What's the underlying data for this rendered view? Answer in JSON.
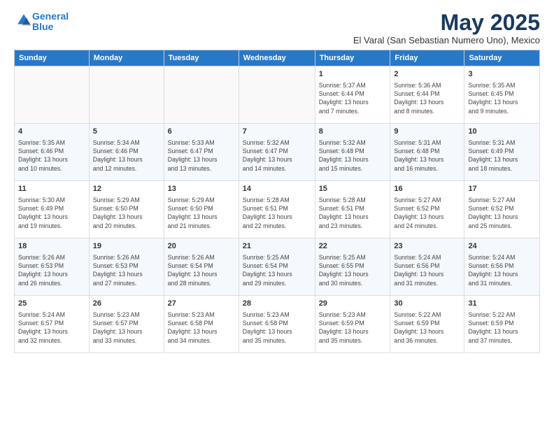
{
  "header": {
    "logo_line1": "General",
    "logo_line2": "Blue",
    "month": "May 2025",
    "location": "El Varal (San Sebastian Numero Uno), Mexico"
  },
  "weekdays": [
    "Sunday",
    "Monday",
    "Tuesday",
    "Wednesday",
    "Thursday",
    "Friday",
    "Saturday"
  ],
  "weeks": [
    [
      {
        "day": "",
        "info": ""
      },
      {
        "day": "",
        "info": ""
      },
      {
        "day": "",
        "info": ""
      },
      {
        "day": "",
        "info": ""
      },
      {
        "day": "1",
        "info": "Sunrise: 5:37 AM\nSunset: 6:44 PM\nDaylight: 13 hours\nand 7 minutes."
      },
      {
        "day": "2",
        "info": "Sunrise: 5:36 AM\nSunset: 6:44 PM\nDaylight: 13 hours\nand 8 minutes."
      },
      {
        "day": "3",
        "info": "Sunrise: 5:35 AM\nSunset: 6:45 PM\nDaylight: 13 hours\nand 9 minutes."
      }
    ],
    [
      {
        "day": "4",
        "info": "Sunrise: 5:35 AM\nSunset: 6:46 PM\nDaylight: 13 hours\nand 10 minutes."
      },
      {
        "day": "5",
        "info": "Sunrise: 5:34 AM\nSunset: 6:46 PM\nDaylight: 13 hours\nand 12 minutes."
      },
      {
        "day": "6",
        "info": "Sunrise: 5:33 AM\nSunset: 6:47 PM\nDaylight: 13 hours\nand 13 minutes."
      },
      {
        "day": "7",
        "info": "Sunrise: 5:32 AM\nSunset: 6:47 PM\nDaylight: 13 hours\nand 14 minutes."
      },
      {
        "day": "8",
        "info": "Sunrise: 5:32 AM\nSunset: 6:48 PM\nDaylight: 13 hours\nand 15 minutes."
      },
      {
        "day": "9",
        "info": "Sunrise: 5:31 AM\nSunset: 6:48 PM\nDaylight: 13 hours\nand 16 minutes."
      },
      {
        "day": "10",
        "info": "Sunrise: 5:31 AM\nSunset: 6:49 PM\nDaylight: 13 hours\nand 18 minutes."
      }
    ],
    [
      {
        "day": "11",
        "info": "Sunrise: 5:30 AM\nSunset: 6:49 PM\nDaylight: 13 hours\nand 19 minutes."
      },
      {
        "day": "12",
        "info": "Sunrise: 5:29 AM\nSunset: 6:50 PM\nDaylight: 13 hours\nand 20 minutes."
      },
      {
        "day": "13",
        "info": "Sunrise: 5:29 AM\nSunset: 6:50 PM\nDaylight: 13 hours\nand 21 minutes."
      },
      {
        "day": "14",
        "info": "Sunrise: 5:28 AM\nSunset: 6:51 PM\nDaylight: 13 hours\nand 22 minutes."
      },
      {
        "day": "15",
        "info": "Sunrise: 5:28 AM\nSunset: 6:51 PM\nDaylight: 13 hours\nand 23 minutes."
      },
      {
        "day": "16",
        "info": "Sunrise: 5:27 AM\nSunset: 6:52 PM\nDaylight: 13 hours\nand 24 minutes."
      },
      {
        "day": "17",
        "info": "Sunrise: 5:27 AM\nSunset: 6:52 PM\nDaylight: 13 hours\nand 25 minutes."
      }
    ],
    [
      {
        "day": "18",
        "info": "Sunrise: 5:26 AM\nSunset: 6:53 PM\nDaylight: 13 hours\nand 26 minutes."
      },
      {
        "day": "19",
        "info": "Sunrise: 5:26 AM\nSunset: 6:53 PM\nDaylight: 13 hours\nand 27 minutes."
      },
      {
        "day": "20",
        "info": "Sunrise: 5:26 AM\nSunset: 6:54 PM\nDaylight: 13 hours\nand 28 minutes."
      },
      {
        "day": "21",
        "info": "Sunrise: 5:25 AM\nSunset: 6:54 PM\nDaylight: 13 hours\nand 29 minutes."
      },
      {
        "day": "22",
        "info": "Sunrise: 5:25 AM\nSunset: 6:55 PM\nDaylight: 13 hours\nand 30 minutes."
      },
      {
        "day": "23",
        "info": "Sunrise: 5:24 AM\nSunset: 6:56 PM\nDaylight: 13 hours\nand 31 minutes."
      },
      {
        "day": "24",
        "info": "Sunrise: 5:24 AM\nSunset: 6:56 PM\nDaylight: 13 hours\nand 31 minutes."
      }
    ],
    [
      {
        "day": "25",
        "info": "Sunrise: 5:24 AM\nSunset: 6:57 PM\nDaylight: 13 hours\nand 32 minutes."
      },
      {
        "day": "26",
        "info": "Sunrise: 5:23 AM\nSunset: 6:57 PM\nDaylight: 13 hours\nand 33 minutes."
      },
      {
        "day": "27",
        "info": "Sunrise: 5:23 AM\nSunset: 6:58 PM\nDaylight: 13 hours\nand 34 minutes."
      },
      {
        "day": "28",
        "info": "Sunrise: 5:23 AM\nSunset: 6:58 PM\nDaylight: 13 hours\nand 35 minutes."
      },
      {
        "day": "29",
        "info": "Sunrise: 5:23 AM\nSunset: 6:59 PM\nDaylight: 13 hours\nand 35 minutes."
      },
      {
        "day": "30",
        "info": "Sunrise: 5:22 AM\nSunset: 6:59 PM\nDaylight: 13 hours\nand 36 minutes."
      },
      {
        "day": "31",
        "info": "Sunrise: 5:22 AM\nSunset: 6:59 PM\nDaylight: 13 hours\nand 37 minutes."
      }
    ]
  ]
}
